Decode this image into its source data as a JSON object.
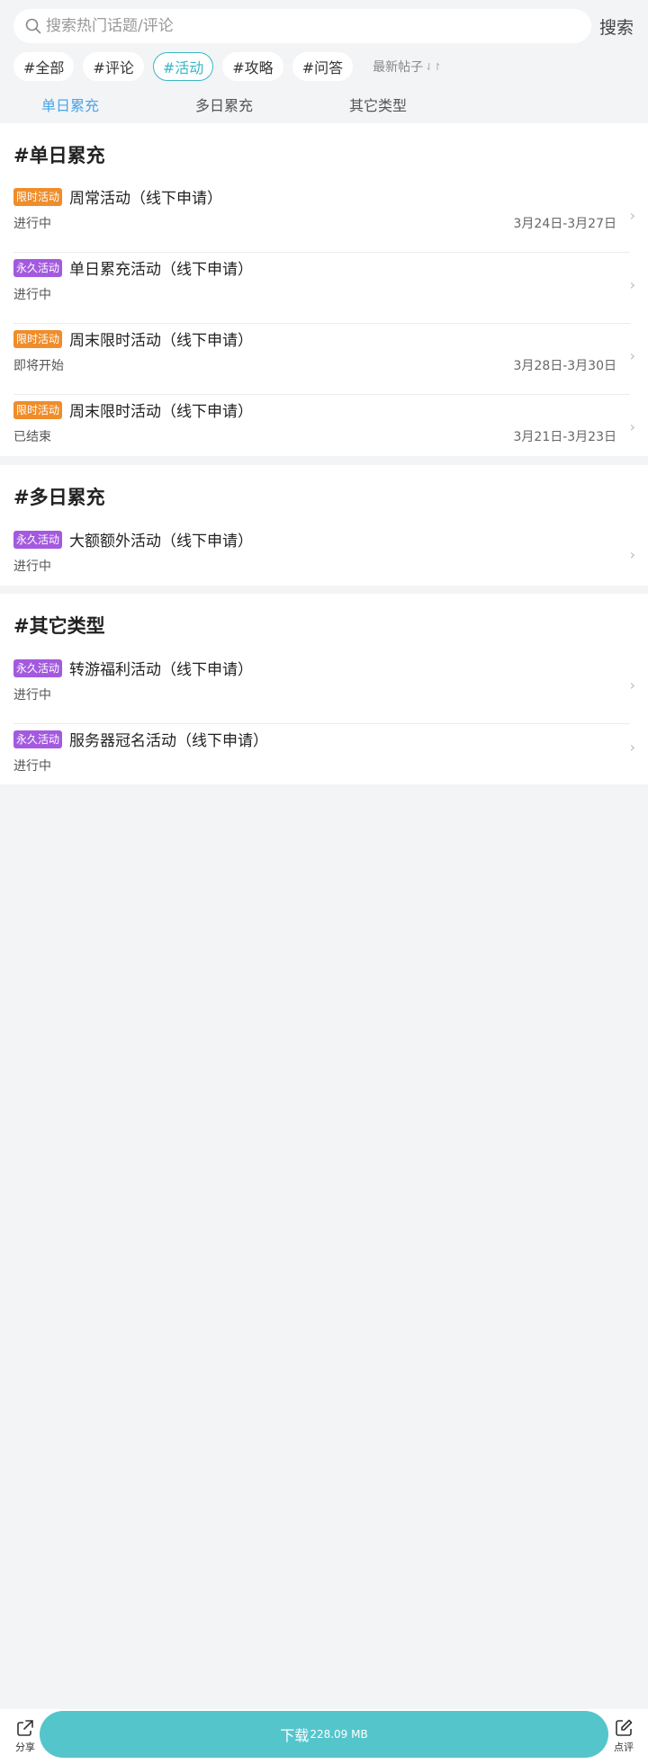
{
  "search": {
    "placeholder": "搜索热门话题/评论",
    "button_label": "搜索"
  },
  "filters": {
    "chips": [
      "#全部",
      "#评论",
      "#活动",
      "#攻略",
      "#问答"
    ],
    "active_chip": "#活动",
    "sort_label": "最新帖子",
    "sort_icon": "sort-arrows-icon"
  },
  "tabs": [
    "单日累充",
    "多日累充",
    "其它类型"
  ],
  "active_tab": "单日累充",
  "colors": {
    "accent": "#3ab7c5",
    "tab_active": "#4aa6e6",
    "tag_limited": "#ef8d2b",
    "tag_permanent": "#a35adf",
    "download_bg": "#55c5cc"
  },
  "sections": [
    {
      "title": "#单日累充",
      "items": [
        {
          "tag": "限时活动",
          "tag_type": "limited",
          "title": "周常活动（线下申请）",
          "status": "进行中",
          "date": "3月24日-3月27日"
        },
        {
          "tag": "永久活动",
          "tag_type": "permanent",
          "title": "单日累充活动（线下申请）",
          "status": "进行中",
          "date": ""
        },
        {
          "tag": "限时活动",
          "tag_type": "limited",
          "title": "周末限时活动（线下申请）",
          "status": "即将开始",
          "date": "3月28日-3月30日"
        },
        {
          "tag": "限时活动",
          "tag_type": "limited",
          "title": "周末限时活动（线下申请）",
          "status": "已结束",
          "date": "3月21日-3月23日"
        }
      ]
    },
    {
      "title": "#多日累充",
      "items": [
        {
          "tag": "永久活动",
          "tag_type": "permanent",
          "title": "大额额外活动（线下申请）",
          "status": "进行中",
          "date": ""
        }
      ]
    },
    {
      "title": "#其它类型",
      "items": [
        {
          "tag": "永久活动",
          "tag_type": "permanent",
          "title": "转游福利活动（线下申请）",
          "status": "进行中",
          "date": ""
        },
        {
          "tag": "永久活动",
          "tag_type": "permanent",
          "title": "服务器冠名活动（线下申请）",
          "status": "进行中",
          "date": ""
        }
      ]
    }
  ],
  "bottom": {
    "share_label": "分享",
    "share_icon": "share-icon",
    "download_label": "下载",
    "download_size": "228.09 MB",
    "review_label": "点评",
    "review_icon": "edit-icon"
  }
}
